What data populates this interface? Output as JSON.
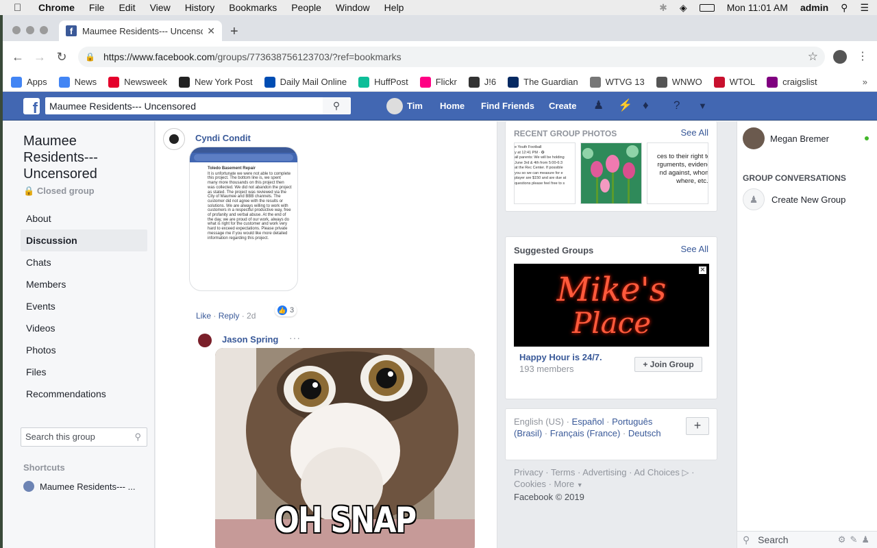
{
  "menubar": {
    "app": "Chrome",
    "items": [
      "File",
      "Edit",
      "View",
      "History",
      "Bookmarks",
      "People",
      "Window",
      "Help"
    ],
    "clock": "Mon 11:01 AM",
    "user": "admin"
  },
  "browser": {
    "tab_title": "Maumee Residents--- Uncensc",
    "url_host": "https://www.facebook.com",
    "url_path": "/groups/773638756123703/?ref=bookmarks",
    "bookmarks": [
      {
        "label": "Apps",
        "icon": "apps-grid-icon",
        "color": "#4285f4"
      },
      {
        "label": "News",
        "icon": "google-news-icon",
        "color": "#4285f4"
      },
      {
        "label": "Newsweek",
        "icon": "newsweek-icon",
        "color": "#e4002b"
      },
      {
        "label": "New York Post",
        "icon": "nypost-icon",
        "color": "#222222"
      },
      {
        "label": "Daily Mail Online",
        "icon": "dailymail-icon",
        "color": "#004db3"
      },
      {
        "label": "HuffPost",
        "icon": "huffpost-icon",
        "color": "#0dbe98"
      },
      {
        "label": "Flickr",
        "icon": "flickr-icon",
        "color": "#ff0084"
      },
      {
        "label": "J!6",
        "icon": "j16-icon",
        "color": "#333333"
      },
      {
        "label": "The Guardian",
        "icon": "guardian-icon",
        "color": "#052962"
      },
      {
        "label": "WTVG 13",
        "icon": "wtvg-icon",
        "color": "#777777"
      },
      {
        "label": "WNWO",
        "icon": "globe-icon",
        "color": "#555555"
      },
      {
        "label": "WTOL",
        "icon": "wtol-icon",
        "color": "#c8102e"
      },
      {
        "label": "craigslist",
        "icon": "peace-icon",
        "color": "#800080"
      }
    ]
  },
  "fb": {
    "search_value": "Maumee Residents--- Uncensored",
    "nav": {
      "user": "Tim",
      "home": "Home",
      "find_friends": "Find Friends",
      "create": "Create"
    },
    "brand_color": "#4267b2"
  },
  "group": {
    "name": "Maumee Residents--- Uncensored",
    "privacy": "Closed group",
    "nav": [
      "About",
      "Discussion",
      "Chats",
      "Members",
      "Events",
      "Videos",
      "Photos",
      "Files",
      "Recommendations"
    ],
    "active_nav": "Discussion",
    "search_placeholder": "Search this group",
    "shortcuts_title": "Shortcuts",
    "shortcut_item": "Maumee Residents--- ..."
  },
  "feed": {
    "comment1": {
      "author": "Cyndi Condit",
      "like": "Like",
      "reply": "Reply",
      "time": "2d",
      "reactions": "3",
      "screenshot": {
        "title": "Toledo Basement Repair",
        "body": "It is unfortunate we were not able to complete this project. The bottom line is, we spent many more thousands on this project then was collected. We did not abandon the project as stated. The project was reviewed via the City of Maumee and BBB channels. The customer did not agree with the results or solutions. We are always willing to work with customers in a respectful productive way, free of profanity and verbal abuse. At the end of the day, we are proud of our work, always do what is right for the customer and work very hard to exceed expectations. Please private message me if you would like more detailed information regarding this project."
      }
    },
    "comment2": {
      "author": "Jason Spring",
      "gif_caption": "OH SNAP"
    }
  },
  "right": {
    "photos_title": "RECENT GROUP PHOTOS",
    "see_all": "See All",
    "photo1_lines": [
      "e Youth Football",
      "y at 12:41 PM · ✪",
      "all parents: We will be holding",
      "June 3rd & 4th from 5:00-6:3",
      "at the Rec Center. If possible",
      "you so we can measure for e",
      "player are $150 and are due at",
      "questions please feel free to s"
    ],
    "photo3_lines": [
      "ces to their right to",
      "rguments, evidenc",
      "nd against, whom",
      "where, etc.\""
    ],
    "suggested_title": "Suggested Groups",
    "suggested_see_all": "See All",
    "suggested_banner": [
      "Mike's",
      "Place"
    ],
    "suggested_name": "Happy Hour is 24/7.",
    "suggested_members": "193 members",
    "join_label": "Join Group",
    "languages": {
      "current": "English (US)",
      "others": [
        "Español",
        "Português (Brasil)",
        "Français (France)",
        "Deutsch"
      ]
    },
    "footer_links": [
      "Privacy",
      "Terms",
      "Advertising",
      "Ad Choices",
      "Cookies",
      "More"
    ],
    "copyright": "Facebook © 2019"
  },
  "chat": {
    "contact": "Megan Bremer",
    "contact_online": true,
    "conversations_title": "GROUP CONVERSATIONS",
    "create_group": "Create New Group",
    "search_placeholder": "Search"
  }
}
